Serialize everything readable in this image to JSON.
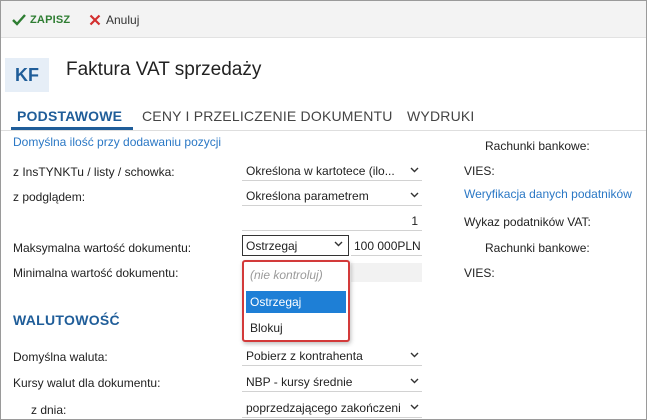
{
  "toolbar": {
    "save_label": "ZAPISZ",
    "cancel_label": "Anuluj"
  },
  "header": {
    "badge": "KF",
    "title": "Faktura VAT sprzedaży"
  },
  "tabs": [
    {
      "label": "PODSTAWOWE",
      "active": true
    },
    {
      "label": "CENY I PRZELICZENIE DOKUMENTU",
      "active": false
    },
    {
      "label": "WYDRUKI",
      "active": false
    }
  ],
  "left": {
    "quantity_section_link": "Domyślna ilość przy dodawaniu pozycji",
    "from_list_label": "z InsTYNKTu / listy / schowka:",
    "from_list_value": "Określona w kartotece (ilo...",
    "preview_label": "z podglądem:",
    "preview_value": "Określona parametrem",
    "quantity_value": "1",
    "max_value_label": "Maksymalna wartość dokumentu:",
    "max_value_mode": "Ostrzegaj",
    "max_value_amount": "100 000PLN",
    "min_value_label": "Minimalna wartość dokumentu:",
    "dropdown_options": [
      "(nie kontroluj)",
      "Ostrzegaj",
      "Blokuj"
    ],
    "dropdown_selected": "Ostrzegaj",
    "currency_section_title": "WALUTOWOŚĆ",
    "default_currency_label": "Domyślna waluta:",
    "default_currency_value": "Pobierz z kontrahenta",
    "rates_label": "Kursy walut dla dokumentu:",
    "rates_value": "NBP - kursy średnie",
    "date_label": "z dnia:",
    "date_value": "poprzedzającego zakończeni"
  },
  "right": {
    "bank_accounts_1": "Rachunki bankowe:",
    "vies_1": "VIES:",
    "verification_link": "Weryfikacja danych podatników",
    "vat_list_label": "Wykaz podatników VAT:",
    "bank_accounts_2": "Rachunki bankowe:",
    "vies_2": "VIES:"
  },
  "colors": {
    "accent": "#1f5d99",
    "link": "#2b78c5",
    "save_green": "#2e7d32",
    "cancel_red": "#d32f2f",
    "dropdown_border": "#d33a3a",
    "selected_bg": "#1e7fd6"
  }
}
